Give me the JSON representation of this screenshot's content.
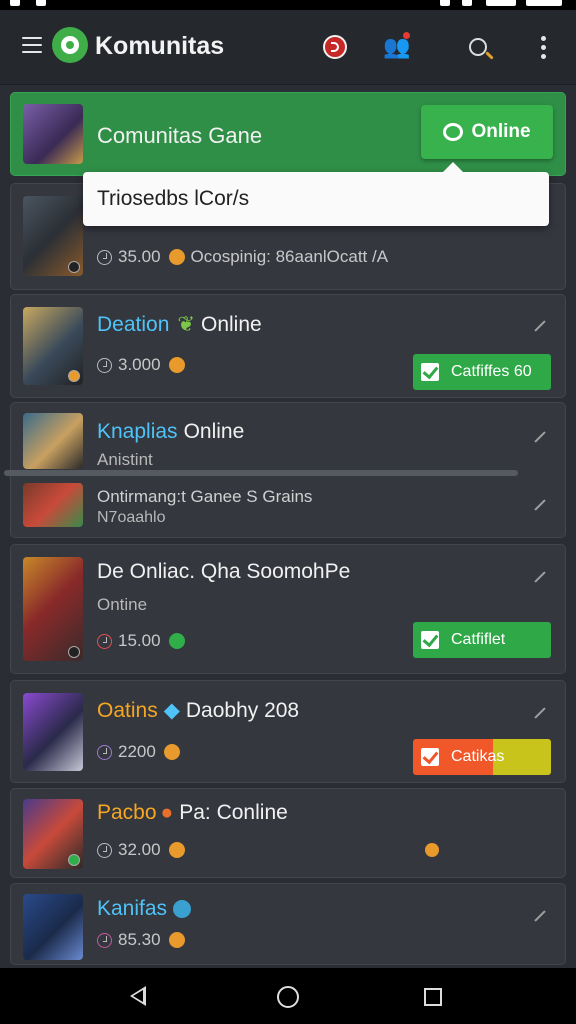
{
  "app": {
    "title": "Komunitas"
  },
  "header": {
    "title": "Comunitas Gane",
    "online_button": "Online"
  },
  "tooltip": {
    "text": "Triosedbs lCor/s"
  },
  "items": [
    {
      "name_hl": "",
      "name": "",
      "sub": "",
      "time": "35.00",
      "extra": "Ocospinig: 86aanlOcatt /A",
      "button": "",
      "hl_color": "#ffffff"
    },
    {
      "name_hl": "Deation",
      "name": "Online",
      "sub": "",
      "time": "3.000",
      "extra": "",
      "button": "Catfiffes 60",
      "hl_color": "#4fc3f7"
    },
    {
      "name_hl": "Knaplias",
      "name": "Online",
      "sub": "Anistint",
      "time": "",
      "extra": "",
      "button": "",
      "hl_color": "#4fc3f7"
    },
    {
      "name_hl": "",
      "name": "Ontirmang:t Ganee S Grains",
      "sub": "N7oaahlo",
      "time": "",
      "extra": "",
      "button": "",
      "hl_color": "#ffffff"
    },
    {
      "name_hl": "",
      "name": "De Onliac. Qha SoomohPe",
      "sub": "Ontine",
      "time": "15.00",
      "extra": "",
      "button": "Catfiflet",
      "hl_color": "#ffffff"
    },
    {
      "name_hl": "Oatins",
      "name": "Daobhy 208",
      "sub": "",
      "time": "2200",
      "extra": "",
      "button": "Catikas",
      "hl_color": "#f5a623"
    },
    {
      "name_hl": "Pacbo",
      "name": "Pa: Conline",
      "sub": "",
      "time": "32.00",
      "extra": "",
      "button": "",
      "hl_color": "#f5a623"
    },
    {
      "name_hl": "Kanifas",
      "name": "",
      "sub": "",
      "time": "85.30",
      "extra": "",
      "button": "",
      "hl_color": "#4fc3f7"
    }
  ],
  "colors": {
    "accent_green": "#2fa847",
    "background": "#2a2d33",
    "card": "#34373e",
    "warn": "#f0582a"
  },
  "icons": [
    "hamburger-icon",
    "app-logo-icon",
    "record-icon",
    "group-icon",
    "search-icon",
    "more-vert-icon",
    "clock-icon",
    "coin-icon",
    "edit-icon",
    "check-icon",
    "chat-bubble-icon",
    "back-icon",
    "home-icon",
    "recents-icon"
  ]
}
